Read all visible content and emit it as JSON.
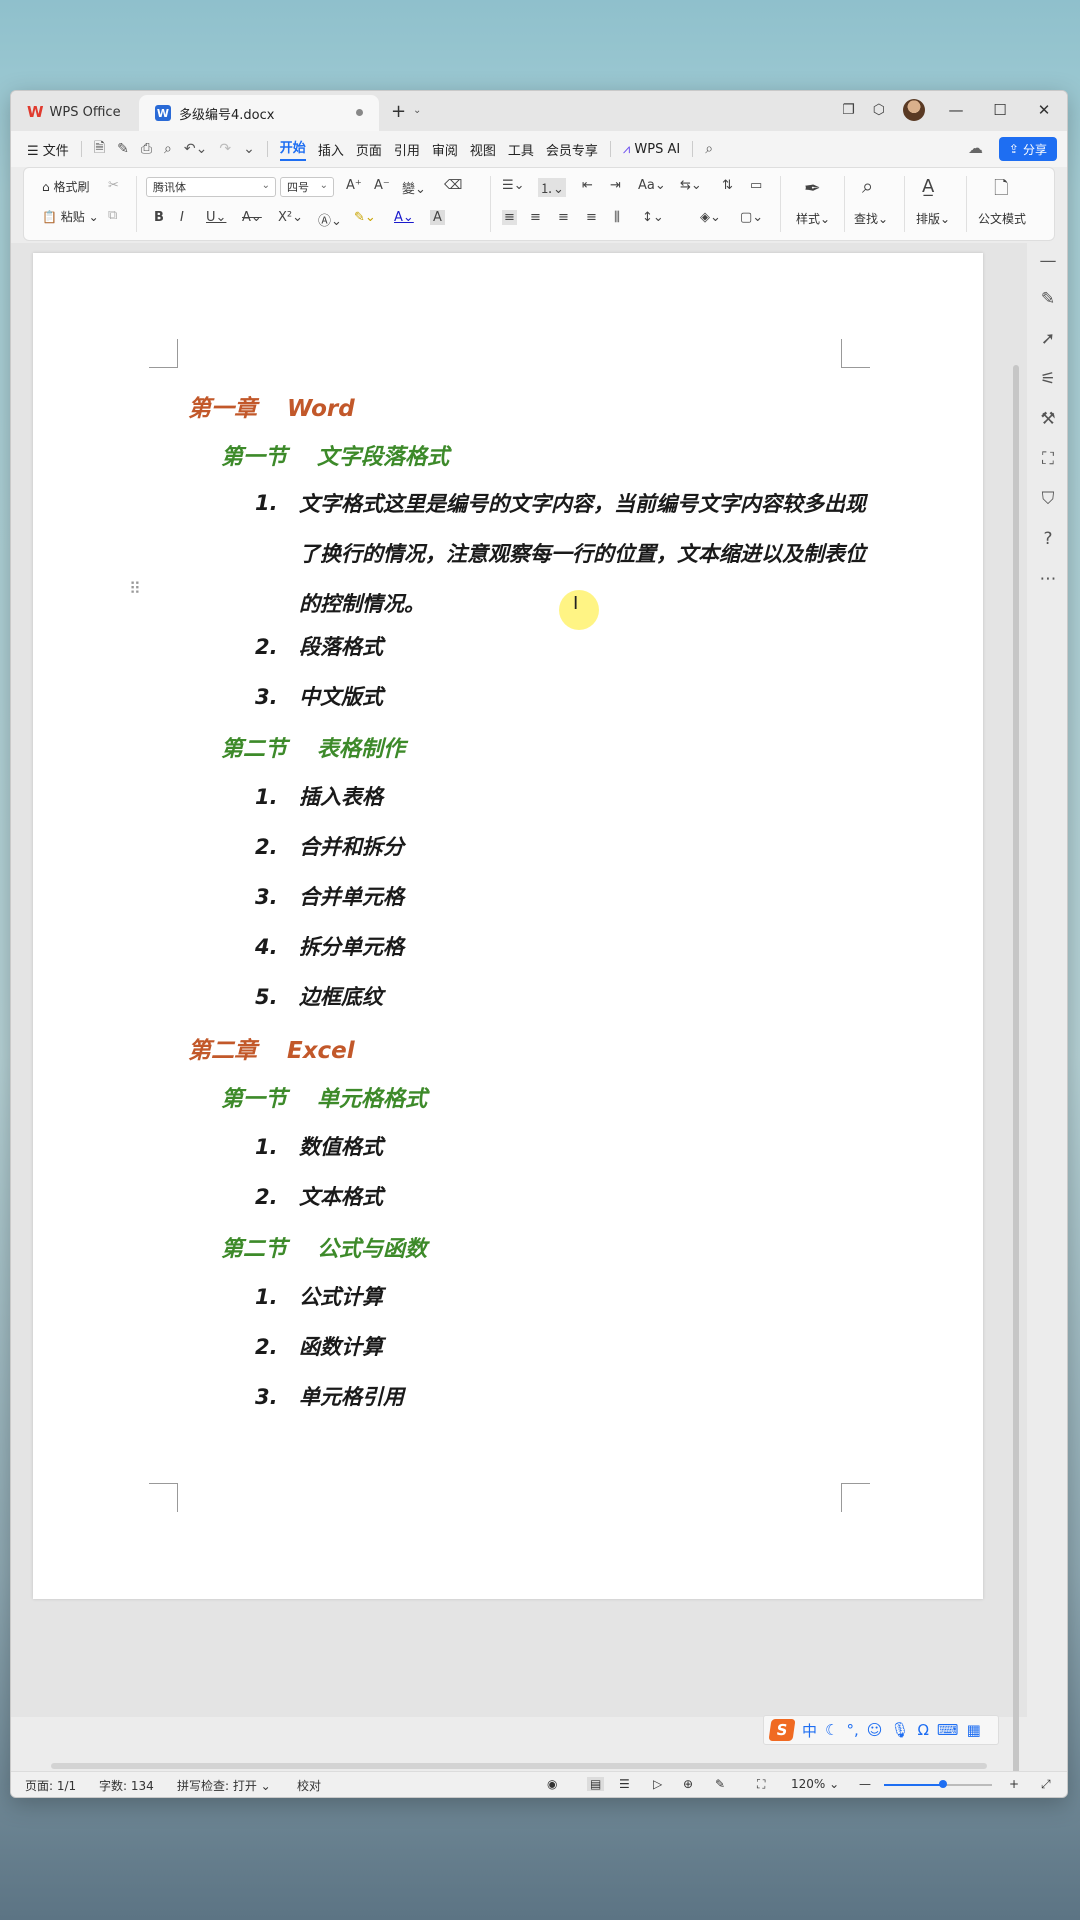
{
  "titlebar": {
    "app_name": "WPS Office",
    "doc_tab": "多级编号4.docx",
    "new_tab": "+"
  },
  "menubar": {
    "file": "文件",
    "tabs": [
      "开始",
      "插入",
      "页面",
      "引用",
      "审阅",
      "视图",
      "工具",
      "会员专享"
    ],
    "wps_ai": "WPS AI",
    "share": "分享"
  },
  "ribbon": {
    "format_painter": "格式刷",
    "paste": "粘贴",
    "font_name": "腾讯体",
    "font_size": "四号",
    "styles": "样式",
    "find": "查找",
    "layout": "排版",
    "official_format": "公文模式"
  },
  "document": {
    "ch1": {
      "label": "第一章",
      "title": "Word"
    },
    "ch1_s1": {
      "label": "第一节",
      "title": "文字段落格式"
    },
    "ch1_s1_items": [
      {
        "num": "1.",
        "text": "文字格式这里是编号的文字内容，当前编号文字内容较多出现了换行的情况，注意观察每一行的位置，文本缩进以及制表位的控制情况。"
      },
      {
        "num": "2.",
        "text": "段落格式"
      },
      {
        "num": "3.",
        "text": "中文版式"
      }
    ],
    "ch1_s2": {
      "label": "第二节",
      "title": "表格制作"
    },
    "ch1_s2_items": [
      {
        "num": "1.",
        "text": "插入表格"
      },
      {
        "num": "2.",
        "text": "合并和拆分"
      },
      {
        "num": "3.",
        "text": "合并单元格"
      },
      {
        "num": "4.",
        "text": "拆分单元格"
      },
      {
        "num": "5.",
        "text": "边框底纹"
      }
    ],
    "ch2": {
      "label": "第二章",
      "title": "Excel"
    },
    "ch2_s1": {
      "label": "第一节",
      "title": "单元格格式"
    },
    "ch2_s1_items": [
      {
        "num": "1.",
        "text": "数值格式"
      },
      {
        "num": "2.",
        "text": "文本格式"
      }
    ],
    "ch2_s2": {
      "label": "第二节",
      "title": "公式与函数"
    },
    "ch2_s2_items": [
      {
        "num": "1.",
        "text": "公式计算"
      },
      {
        "num": "2.",
        "text": "函数计算"
      },
      {
        "num": "3.",
        "text": "单元格引用"
      }
    ]
  },
  "ime": {
    "mode": "中"
  },
  "statusbar": {
    "page": "页面: 1/1",
    "words": "字数: 134",
    "spellcheck": "拼写检查: 打开",
    "proofread": "校对",
    "zoom": "120%",
    "zoom_level": 0.55
  },
  "colors": {
    "accent": "#1e6ef2",
    "chapter": "#c2582a",
    "section": "#3d8a2a"
  }
}
